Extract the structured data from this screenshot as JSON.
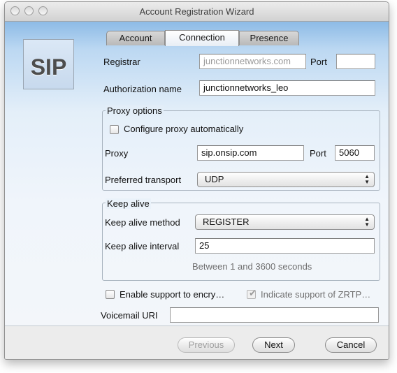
{
  "window": {
    "title": "Account Registration Wizard"
  },
  "logo": {
    "text": "SIP"
  },
  "tabs": [
    {
      "label": "Account",
      "active": false
    },
    {
      "label": "Connection",
      "active": true
    },
    {
      "label": "Presence",
      "active": false
    }
  ],
  "form": {
    "registrar_label": "Registrar",
    "registrar_placeholder": "junctionnetworks.com",
    "port_label": "Port",
    "port_value": "",
    "auth_label": "Authorization name",
    "auth_value": "junctionnetworks_leo"
  },
  "proxy": {
    "group_title": "Proxy options",
    "auto_label": "Configure proxy automatically",
    "auto_checked": false,
    "proxy_label": "Proxy",
    "proxy_value": "sip.onsip.com",
    "port_label": "Port",
    "port_value": "5060",
    "transport_label": "Preferred transport",
    "transport_value": "UDP"
  },
  "keepalive": {
    "group_title": "Keep alive",
    "method_label": "Keep alive method",
    "method_value": "REGISTER",
    "interval_label": "Keep alive interval",
    "interval_value": "25",
    "hint": "Between 1 and 3600 seconds"
  },
  "encryption": {
    "enable_label": "Enable support to encry…",
    "enable_checked": false,
    "zrtp_label": "Indicate support of ZRTP…",
    "zrtp_checked": true
  },
  "voicemail": {
    "label": "Voicemail URI",
    "value": ""
  },
  "buttons": {
    "previous": "Previous",
    "next": "Next",
    "cancel": "Cancel"
  },
  "colors": {
    "content_gradient_top": "#8dbbe6",
    "content_gradient_bottom": "#f3f6fa",
    "footer": "#ececec"
  }
}
